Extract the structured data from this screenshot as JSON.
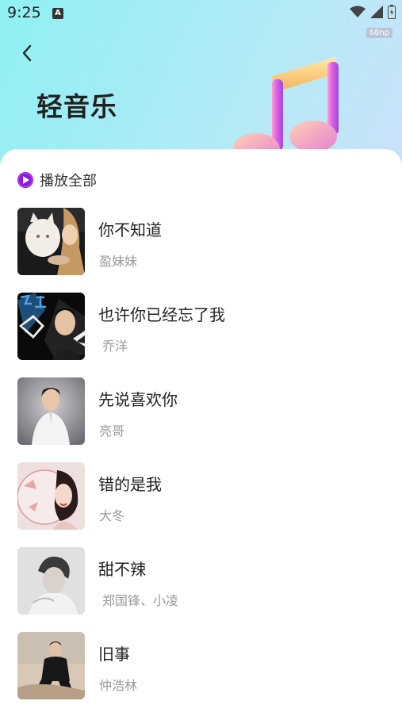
{
  "status": {
    "time": "9:25",
    "fps": "68np"
  },
  "header": {
    "title": "轻音乐"
  },
  "play_all": {
    "label": "播放全部"
  },
  "songs": [
    {
      "title": "你不知道",
      "artist": "盈妹妹"
    },
    {
      "title": "也许你已经忘了我",
      "artist": "乔洋"
    },
    {
      "title": "先说喜欢你",
      "artist": "亮哥"
    },
    {
      "title": "错的是我",
      "artist": "大冬"
    },
    {
      "title": "甜不辣",
      "artist": "郑国锋、小凌"
    },
    {
      "title": "旧事",
      "artist": "仲浩林"
    }
  ],
  "colors": {
    "accent": "#8a19d9",
    "title_text": "#222222",
    "subtitle_text": "#9a9a9a"
  }
}
